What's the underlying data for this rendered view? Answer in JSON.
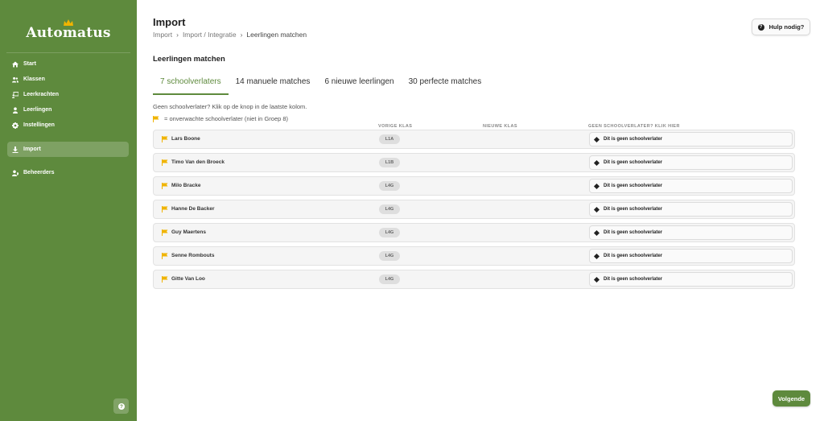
{
  "app": {
    "brand": "Automatus"
  },
  "sidebar": {
    "items": [
      {
        "label": "Start",
        "icon": "home-icon"
      },
      {
        "label": "Klassen",
        "icon": "users-icon"
      },
      {
        "label": "Leerkrachten",
        "icon": "teacher-icon"
      },
      {
        "label": "Leerlingen",
        "icon": "student-icon"
      },
      {
        "label": "Instellingen",
        "icon": "gear-icon"
      },
      {
        "label": "Import",
        "icon": "import-icon",
        "active": true
      },
      {
        "label": "Beheerders",
        "icon": "admin-icon"
      }
    ],
    "help_icon": "question-icon"
  },
  "header": {
    "title": "Import",
    "breadcrumb": [
      "Import",
      "Import / Integratie",
      "Leerlingen matchen"
    ],
    "help_button": "Hulp nodig?"
  },
  "section": {
    "title": "Leerlingen matchen"
  },
  "tabs": [
    {
      "label": "7 schoolverlaters",
      "active": true
    },
    {
      "label": "14 manuele matches"
    },
    {
      "label": "6 nieuwe leerlingen"
    },
    {
      "label": "30 perfecte matches"
    }
  ],
  "notes": {
    "instruction": "Geen schoolverlater? Klik op de knop in de laatste kolom.",
    "legend": "= onverwachte schoolverlater (niet in Groep 8)"
  },
  "table": {
    "columns": [
      "VORIGE KLAS",
      "NIEUWE KLAS",
      "GEEN SCHOOLVERLATER? KLIK HIER"
    ],
    "rows": [
      {
        "name": "Lars Boone",
        "klas": "L1A",
        "button": "Dit is geen schoolverlater"
      },
      {
        "name": "Timo Van den Broeck",
        "klas": "L1B",
        "button": "Dit is geen schoolverlater"
      },
      {
        "name": "Milo Bracke",
        "klas": "L4G",
        "button": "Dit is geen schoolverlater"
      },
      {
        "name": "Hanne De Backer",
        "klas": "L4G",
        "button": "Dit is geen schoolverlater"
      },
      {
        "name": "Guy Maertens",
        "klas": "L4G",
        "button": "Dit is geen schoolverlater"
      },
      {
        "name": "Senne Rombouts",
        "klas": "L4G",
        "button": "Dit is geen schoolverlater"
      },
      {
        "name": "Gitte Van Loo",
        "klas": "L4G",
        "button": "Dit is geen schoolverlater"
      }
    ]
  },
  "footer": {
    "next_button": "Volgende"
  },
  "colors": {
    "sidebar": "#5e8a3d",
    "accent": "#5e8a3d",
    "flag": "#f0b400"
  }
}
